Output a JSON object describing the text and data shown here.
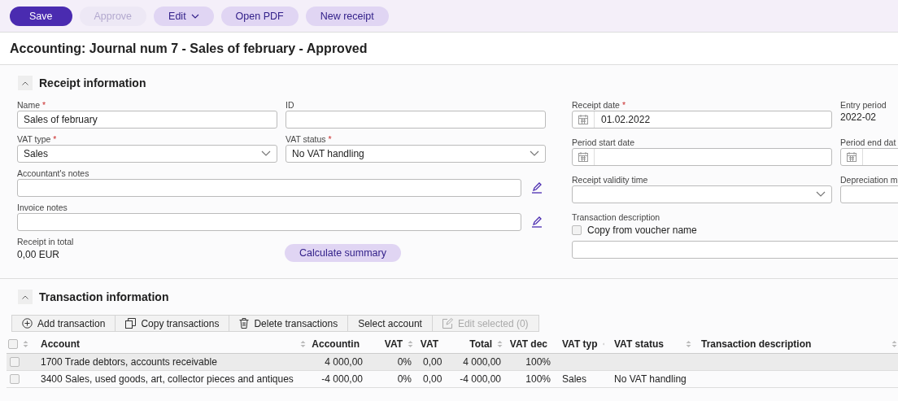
{
  "toolbar": [
    {
      "label": "Save",
      "kind": "primary",
      "disabled": false
    },
    {
      "label": "Approve",
      "kind": "secondary",
      "disabled": true
    },
    {
      "label": "Edit",
      "kind": "dropdown",
      "disabled": false
    },
    {
      "label": "Open PDF",
      "kind": "secondary",
      "disabled": false
    },
    {
      "label": "New receipt",
      "kind": "secondary",
      "disabled": false
    }
  ],
  "title": "Accounting: Journal num 7 - Sales of february - Approved",
  "receipt_section": {
    "title": "Receipt information",
    "expanded": true,
    "left_fields": [
      {
        "label": "Name",
        "marker": "*",
        "kind": "text",
        "value": "Sales of february"
      },
      {
        "label": "ID",
        "kind": "text"
      },
      {
        "label": "VAT type",
        "marker": "*",
        "kind": "select",
        "value": "Sales"
      },
      {
        "label": "VAT status",
        "marker": "*",
        "kind": "select",
        "value": "No VAT handling"
      },
      {
        "label": "Accountant's notes",
        "kind": "notes"
      },
      {
        "label": "Invoice notes",
        "kind": "notes"
      }
    ],
    "total_label": "Receipt in total",
    "total_value": "0,00 EUR",
    "calculate_button": "Calculate summary",
    "right_fields": [
      {
        "label": "Receipt date",
        "marker": "*",
        "kind": "date",
        "value": "01.02.2022"
      },
      {
        "label": "Entry period",
        "kind": "readonly",
        "value": "2022-02"
      },
      {
        "label": "Period start date",
        "kind": "date"
      },
      {
        "label": "Period end dat",
        "kind": "date"
      },
      {
        "label": "Receipt validity time",
        "kind": "select"
      },
      {
        "label": "Depreciation m",
        "kind": "text"
      },
      {
        "label": "Transaction description",
        "kind": "checkbox-text",
        "checkbox_label": "Copy from voucher name",
        "checked": false
      }
    ]
  },
  "transaction_section": {
    "title": "Transaction information",
    "expanded": true,
    "actions": [
      {
        "label": "Add transaction",
        "kind": "add",
        "disabled": false
      },
      {
        "label": "Copy transactions",
        "kind": "copy",
        "disabled": false
      },
      {
        "label": "Delete transactions",
        "kind": "delete",
        "disabled": false
      },
      {
        "label": "Select account",
        "kind": "plain",
        "disabled": false
      },
      {
        "label": "Edit selected (0)",
        "kind": "edit",
        "disabled": true
      }
    ],
    "table": {
      "select_all_checked": false,
      "columns": [
        "Account",
        "Accountin",
        "VAT",
        "VAT",
        "Total",
        "VAT dec",
        "VAT typ",
        "VAT status",
        "Transaction description"
      ],
      "rows": [
        {
          "selected": true,
          "checked": false,
          "cells": [
            "1700 Trade debtors, accounts receivable",
            "4 000,00",
            "0%",
            "0,00",
            "4 000,00",
            "100%",
            "",
            "",
            ""
          ]
        },
        {
          "selected": false,
          "checked": false,
          "cells": [
            "3400 Sales, used goods, art, collector pieces and antiques",
            "-4 000,00",
            "0%",
            "0,00",
            "-4 000,00",
            "100%",
            "Sales",
            "No VAT handling",
            ""
          ]
        }
      ]
    }
  }
}
